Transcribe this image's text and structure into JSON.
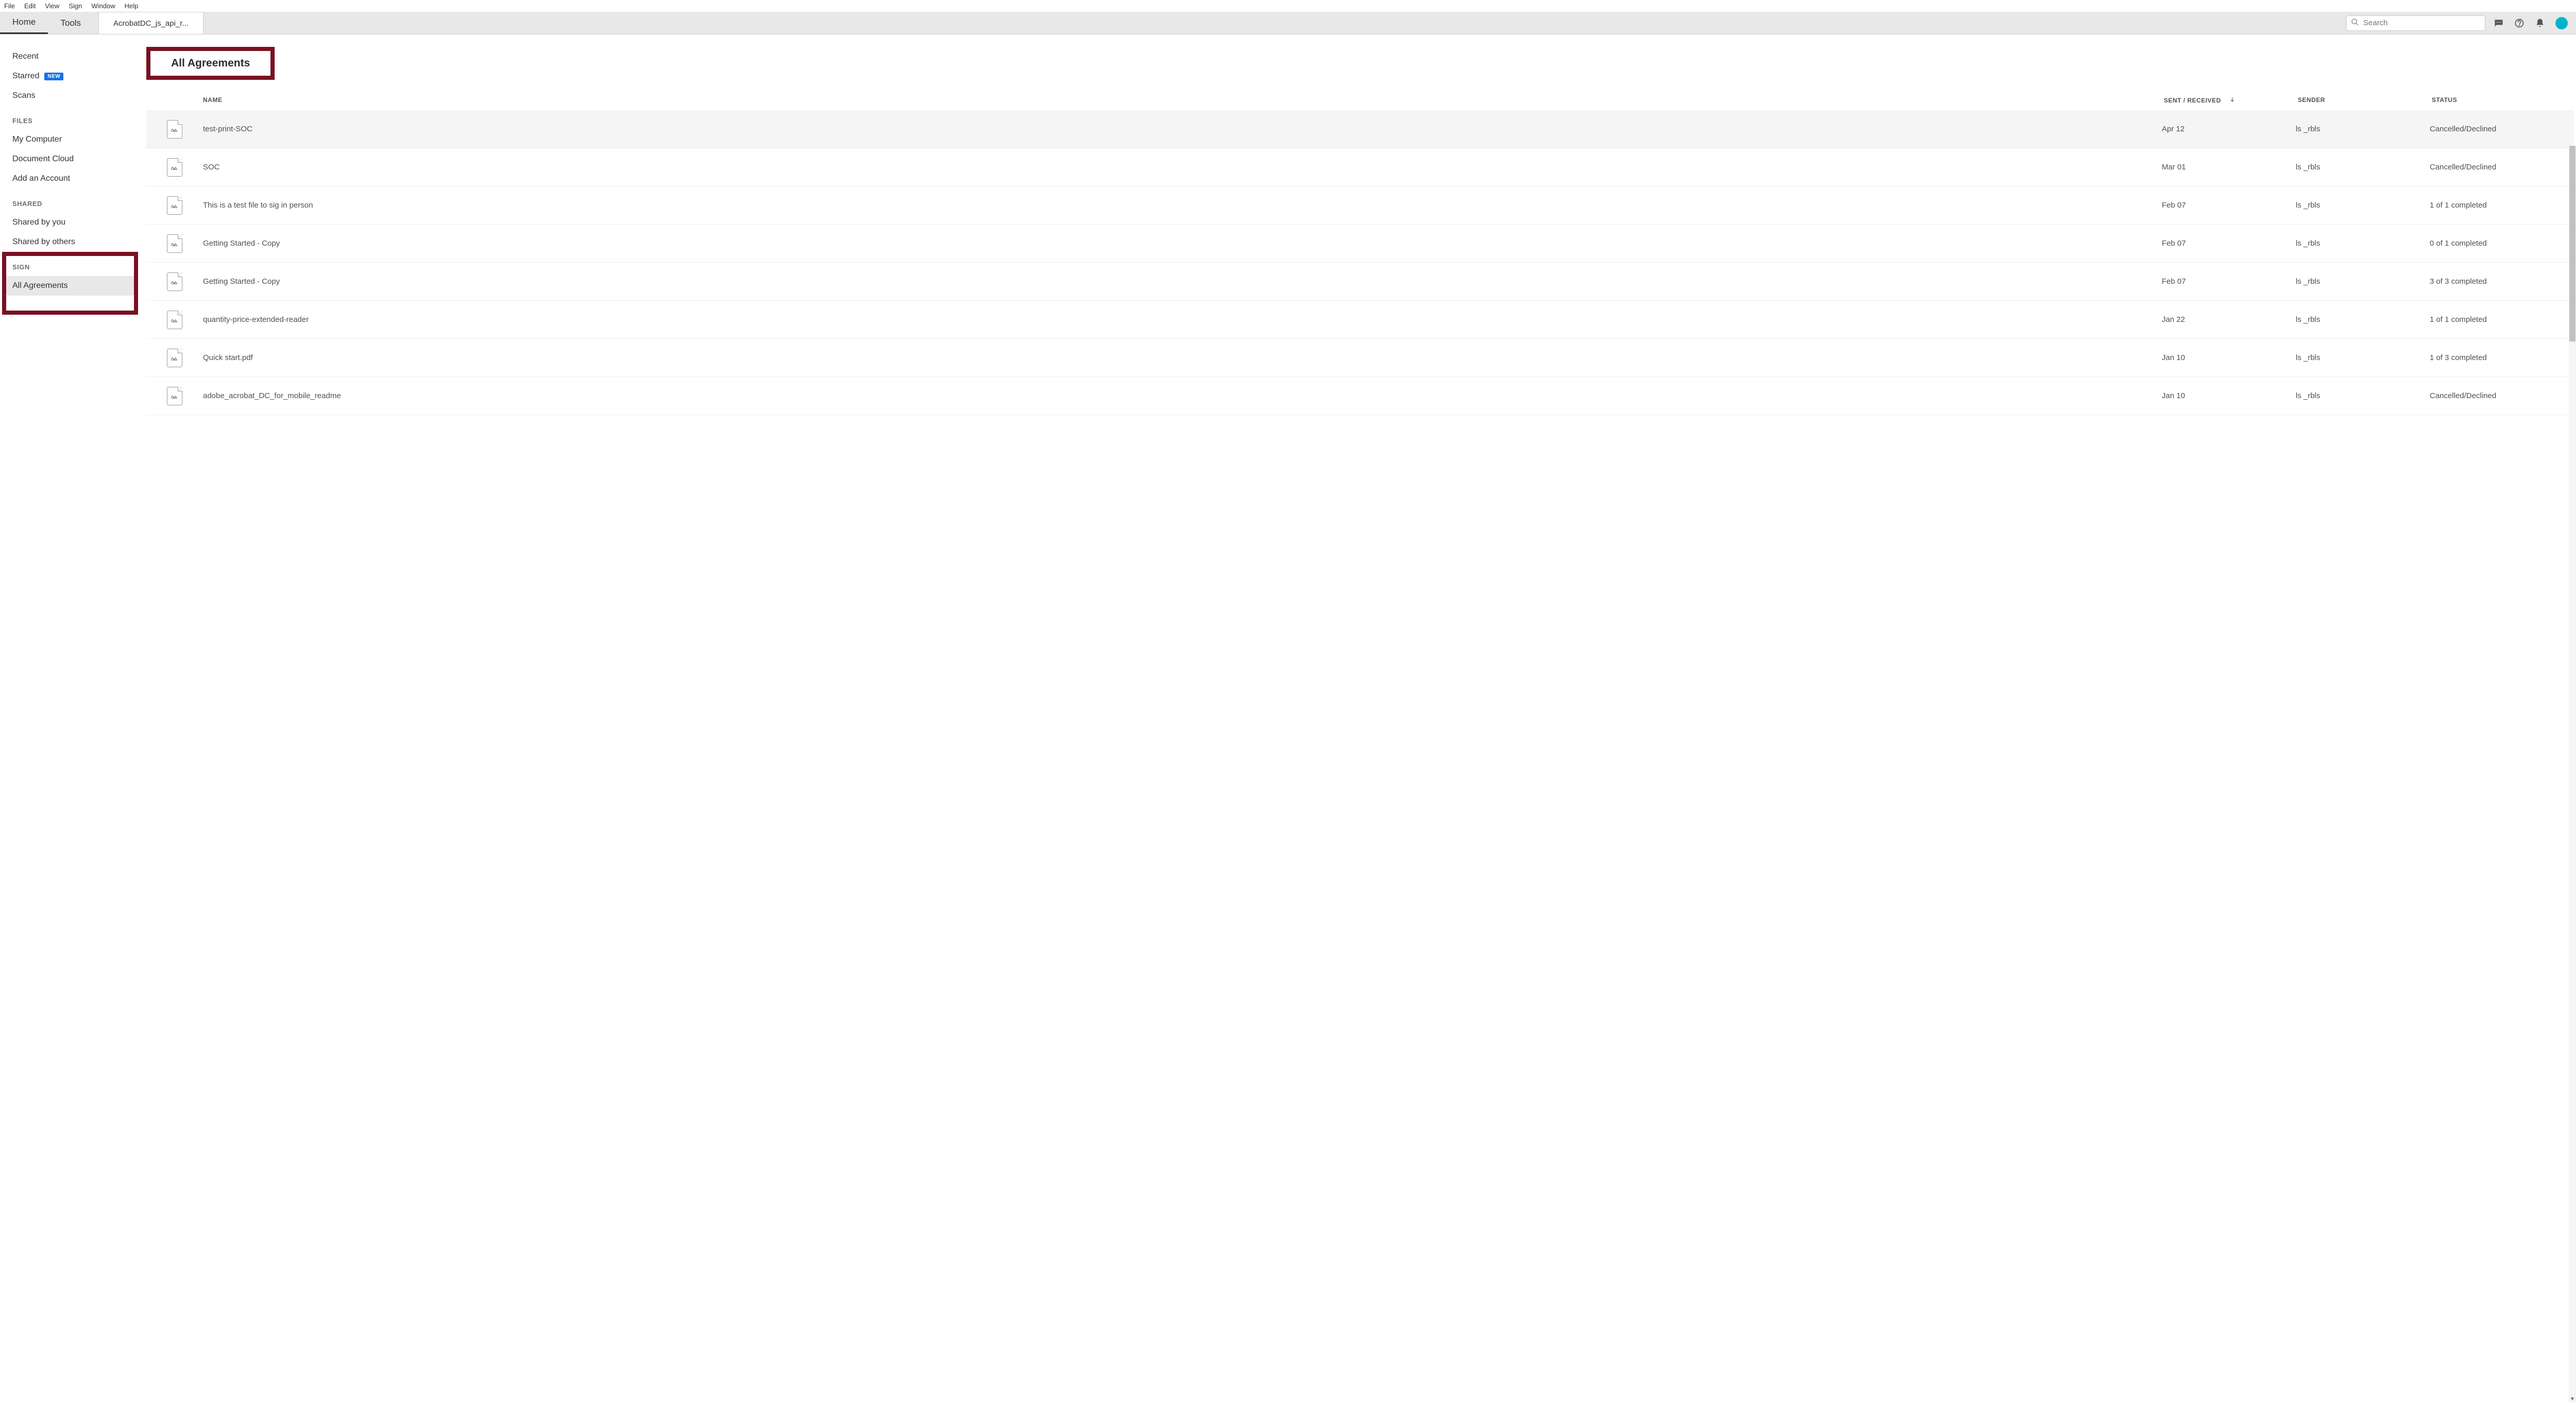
{
  "menubar": {
    "items": [
      "File",
      "Edit",
      "View",
      "Sign",
      "Window",
      "Help"
    ]
  },
  "toolbar": {
    "tabs": {
      "home": "Home",
      "tools": "Tools"
    },
    "doc_tab": "AcrobatDC_js_api_r...",
    "search_placeholder": "Search"
  },
  "sidebar": {
    "recent": "Recent",
    "starred": "Starred",
    "new_badge": "NEW",
    "scans": "Scans",
    "files_heading": "FILES",
    "my_computer": "My Computer",
    "document_cloud": "Document Cloud",
    "add_account": "Add an Account",
    "shared_heading": "SHARED",
    "shared_by_you": "Shared by you",
    "shared_by_others": "Shared by others",
    "sign_heading": "SIGN",
    "all_agreements": "All Agreements"
  },
  "main": {
    "title": "All Agreements",
    "columns": {
      "name": "NAME",
      "sent_received": "SENT / RECEIVED",
      "sender": "SENDER",
      "status": "STATUS"
    },
    "rows": [
      {
        "name": "test-print-SOC",
        "date": "Apr 12",
        "sender": "ls _rbls",
        "status": "Cancelled/Declined"
      },
      {
        "name": "SOC",
        "date": "Mar 01",
        "sender": "ls _rbls",
        "status": "Cancelled/Declined"
      },
      {
        "name": "This is a test file to sig in person",
        "date": "Feb 07",
        "sender": "ls _rbls",
        "status": "1 of 1 completed"
      },
      {
        "name": "Getting Started - Copy",
        "date": "Feb 07",
        "sender": "ls _rbls",
        "status": "0 of 1 completed"
      },
      {
        "name": "Getting Started - Copy",
        "date": "Feb 07",
        "sender": "ls _rbls",
        "status": "3 of 3 completed"
      },
      {
        "name": "quantity-price-extended-reader",
        "date": "Jan 22",
        "sender": "ls _rbls",
        "status": "1 of 1 completed"
      },
      {
        "name": "Quick start.pdf",
        "date": "Jan 10",
        "sender": "ls _rbls",
        "status": "1 of 3 completed"
      },
      {
        "name": "adobe_acrobat_DC_for_mobile_readme",
        "date": "Jan 10",
        "sender": "ls _rbls",
        "status": "Cancelled/Declined"
      }
    ]
  }
}
